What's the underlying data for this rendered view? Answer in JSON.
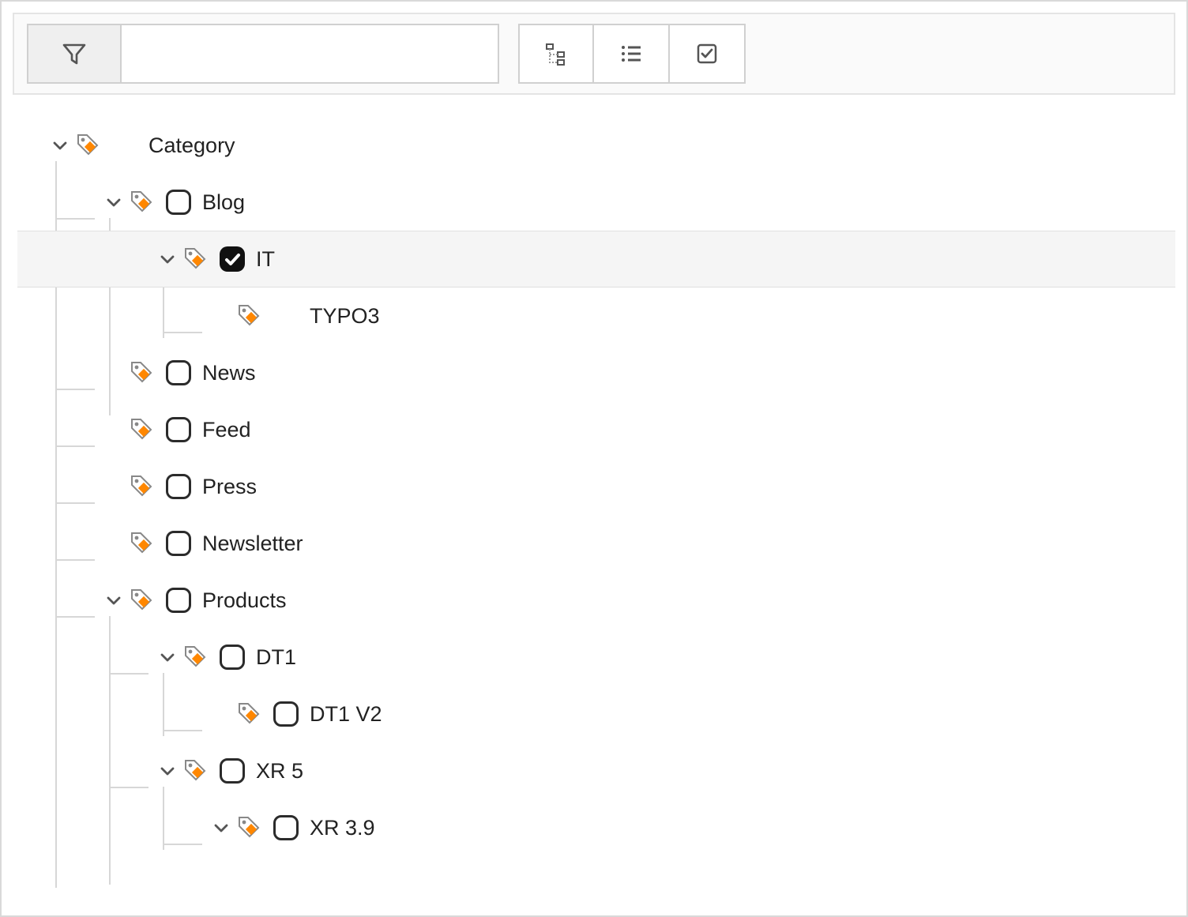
{
  "toolbar": {
    "filter_placeholder": ""
  },
  "tree": {
    "root": {
      "label": "Category",
      "expanded": true,
      "checkbox": null,
      "children": [
        {
          "label": "Blog",
          "expanded": true,
          "checkbox": false,
          "children": [
            {
              "label": "IT",
              "expanded": true,
              "checkbox": true,
              "selected": true,
              "children": [
                {
                  "label": "TYPO3",
                  "expanded": false,
                  "checkbox": null,
                  "children": []
                }
              ]
            }
          ]
        },
        {
          "label": "News",
          "expanded": false,
          "checkbox": false,
          "children": []
        },
        {
          "label": "Feed",
          "expanded": false,
          "checkbox": false,
          "children": []
        },
        {
          "label": "Press",
          "expanded": false,
          "checkbox": false,
          "children": []
        },
        {
          "label": "Newsletter",
          "expanded": false,
          "checkbox": false,
          "children": []
        },
        {
          "label": "Products",
          "expanded": true,
          "checkbox": false,
          "children": [
            {
              "label": "DT1",
              "expanded": true,
              "checkbox": false,
              "children": [
                {
                  "label": "DT1 V2",
                  "expanded": false,
                  "checkbox": false,
                  "children": []
                }
              ]
            },
            {
              "label": "XR 5",
              "expanded": true,
              "checkbox": false,
              "children": [
                {
                  "label": "XR 3.9",
                  "expanded": true,
                  "checkbox": false,
                  "children": []
                }
              ]
            }
          ]
        }
      ]
    }
  },
  "icons": {
    "filter": "filter-icon",
    "tree": "tree-view-icon",
    "list": "list-view-icon",
    "checkall": "check-icon"
  }
}
